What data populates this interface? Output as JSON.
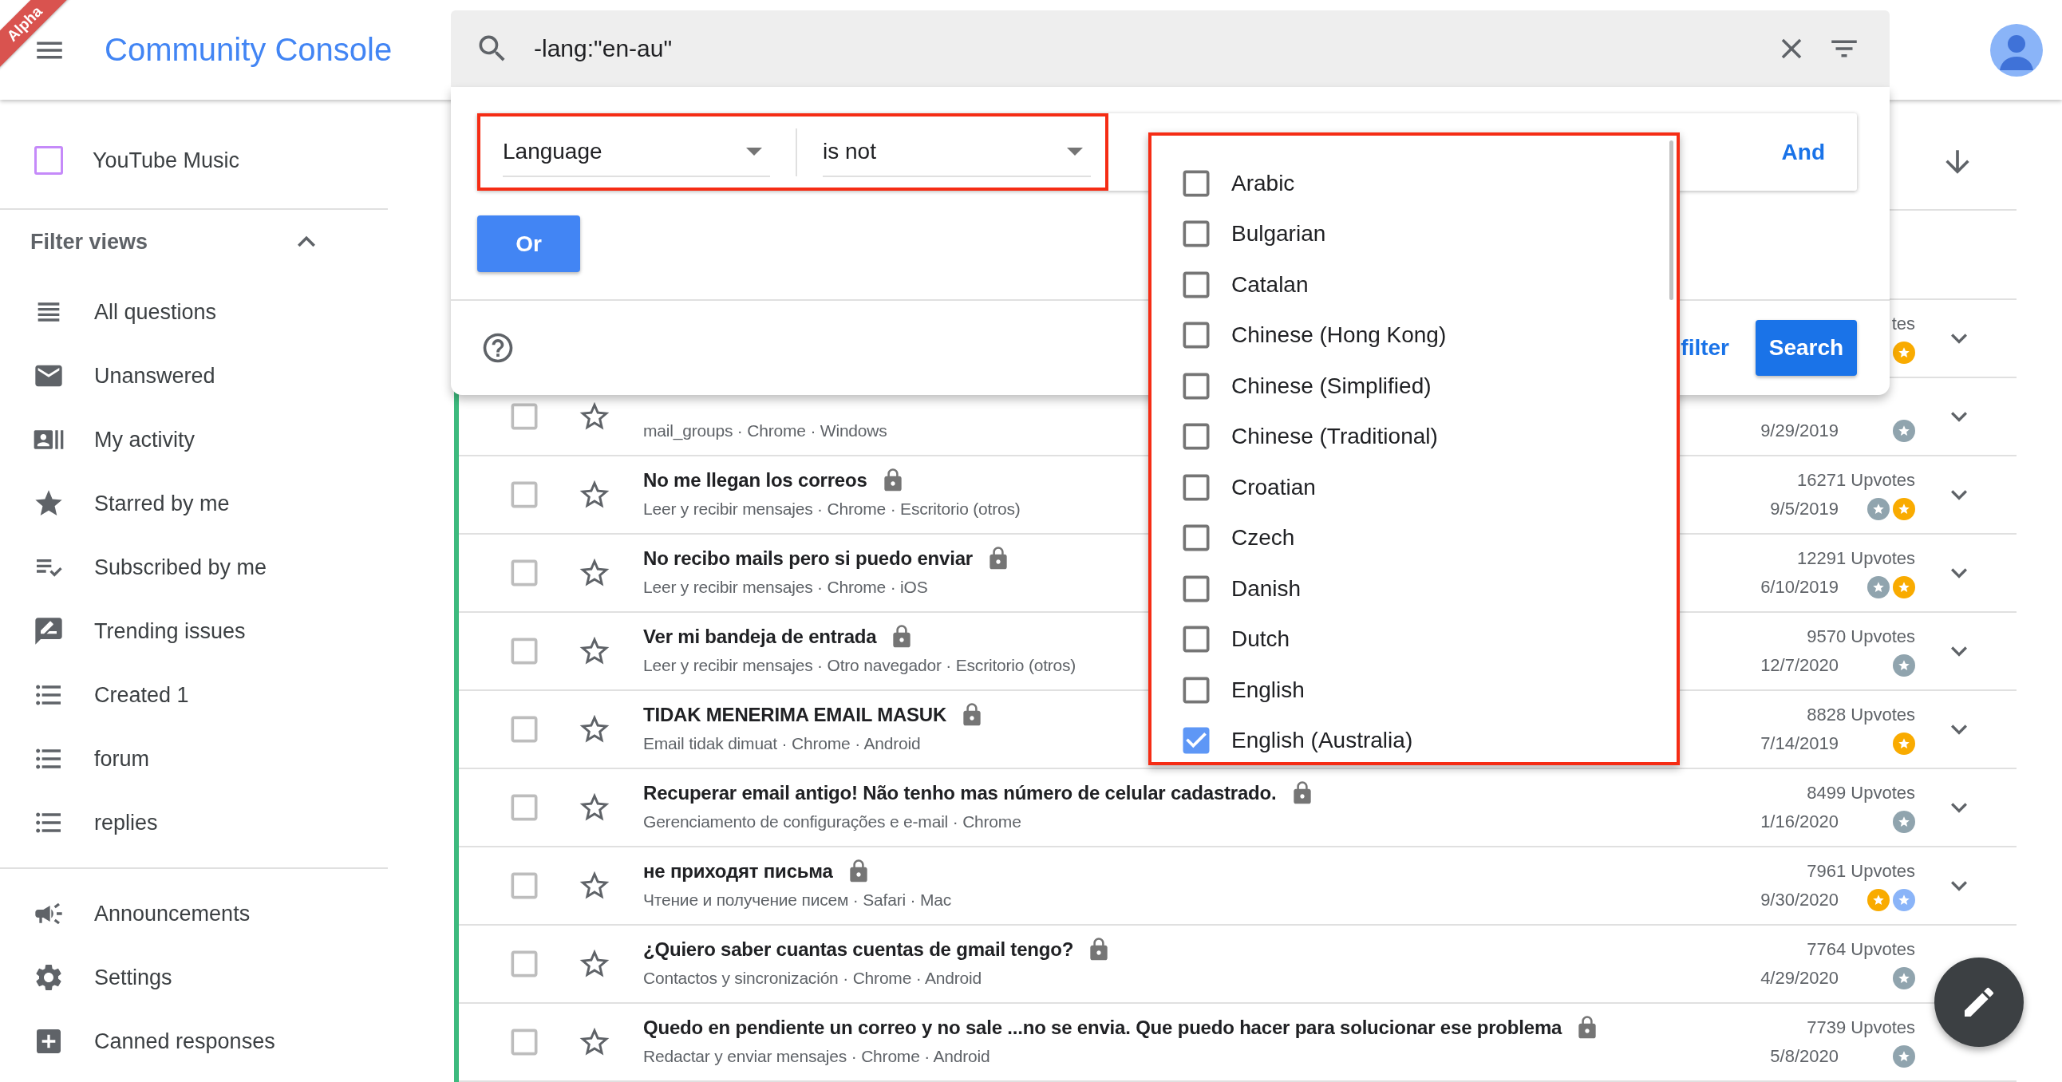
{
  "alpha_ribbon": "Alpha",
  "header": {
    "title": "Community Console"
  },
  "search": {
    "value": "-lang:\"en-au\""
  },
  "sidebar": {
    "channels": [
      {
        "label": "YouTube Music",
        "color": "#c58af9"
      }
    ],
    "filter_views": {
      "title": "Filter views",
      "expanded": true,
      "items": [
        {
          "kind": "all",
          "label": "All questions"
        },
        {
          "kind": "unanswered",
          "label": "Unanswered"
        },
        {
          "kind": "activity",
          "label": "My activity"
        },
        {
          "kind": "starred",
          "label": "Starred by me"
        },
        {
          "kind": "subscribed",
          "label": "Subscribed by me"
        },
        {
          "kind": "trending",
          "label": "Trending issues"
        },
        {
          "kind": "list",
          "label": "Created 1"
        },
        {
          "kind": "list",
          "label": "forum"
        },
        {
          "kind": "list",
          "label": "replies"
        }
      ]
    },
    "bottom_items": [
      {
        "kind": "announcements",
        "label": "Announcements"
      },
      {
        "kind": "settings",
        "label": "Settings"
      },
      {
        "kind": "canned",
        "label": "Canned responses"
      }
    ]
  },
  "filter_popup": {
    "conditions": [
      {
        "field": "Language",
        "operator": "is not"
      }
    ],
    "and_button": "And",
    "or_button": "Or",
    "clear_link": "filter",
    "search_button": "Search",
    "options": [
      {
        "label": "Arabic",
        "checked": false
      },
      {
        "label": "Bulgarian",
        "checked": false
      },
      {
        "label": "Catalan",
        "checked": false
      },
      {
        "label": "Chinese (Hong Kong)",
        "checked": false
      },
      {
        "label": "Chinese (Simplified)",
        "checked": false
      },
      {
        "label": "Chinese (Traditional)",
        "checked": false
      },
      {
        "label": "Croatian",
        "checked": false
      },
      {
        "label": "Czech",
        "checked": false
      },
      {
        "label": "Danish",
        "checked": false
      },
      {
        "label": "Dutch",
        "checked": false
      },
      {
        "label": "English",
        "checked": false
      },
      {
        "label": "English (Australia)",
        "checked": true
      }
    ]
  },
  "questions": [
    {
      "upvotes": "tes",
      "badges": [
        {
          "color": "#f9ab00"
        }
      ],
      "expand_icon": true
    },
    {
      "checked": false,
      "starred": false,
      "subtitle": "mail_groups · Chrome · Windows",
      "date": "9/29/2019",
      "badges": [
        {
          "color": "#90a4ae"
        }
      ],
      "expand_icon": true
    },
    {
      "checked": false,
      "starred": false,
      "title": "No me llegan los correos",
      "locked": true,
      "subtitle": "Leer y recibir mensajes · Chrome · Escritorio (otros)",
      "upvotes": "16271 Upvotes",
      "date": "9/5/2019",
      "badges": [
        {
          "color": "#90a4ae"
        },
        {
          "color": "#f9ab00"
        }
      ],
      "expand_icon": true
    },
    {
      "checked": false,
      "starred": false,
      "title": "No recibo mails pero si puedo enviar",
      "locked": true,
      "subtitle": "Leer y recibir mensajes · Chrome · iOS",
      "upvotes": "12291 Upvotes",
      "date": "6/10/2019",
      "badges": [
        {
          "color": "#90a4ae"
        },
        {
          "color": "#f9ab00"
        }
      ],
      "expand_icon": true
    },
    {
      "checked": false,
      "starred": false,
      "title": "Ver mi bandeja de entrada",
      "locked": true,
      "subtitle": "Leer y recibir mensajes · Otro navegador · Escritorio (otros)",
      "upvotes": "9570 Upvotes",
      "date": "12/7/2020",
      "badges": [
        {
          "color": "#90a4ae"
        }
      ],
      "expand_icon": true
    },
    {
      "checked": false,
      "starred": false,
      "title": "TIDAK MENERIMA EMAIL MASUK",
      "locked": true,
      "subtitle": "Email tidak dimuat · Chrome · Android",
      "upvotes": "8828 Upvotes",
      "date": "7/14/2019",
      "badges": [
        {
          "color": "#f9ab00"
        }
      ],
      "expand_icon": true
    },
    {
      "checked": false,
      "starred": false,
      "title": "Recuperar email antigo! Não tenho mas número de celular cadastrado.",
      "locked": true,
      "subtitle": "Gerenciamento de configurações e e-mail · Chrome",
      "upvotes": "8499 Upvotes",
      "date": "1/16/2020",
      "badges": [
        {
          "color": "#90a4ae"
        }
      ],
      "expand_icon": true
    },
    {
      "checked": false,
      "starred": false,
      "title": "не приходят письма",
      "locked": true,
      "subtitle": "Чтение и получение писем · Safari · Mac",
      "upvotes": "7961 Upvotes",
      "date": "9/30/2020",
      "badges": [
        {
          "color": "#f9ab00"
        },
        {
          "color": "#8ab4f8"
        }
      ],
      "expand_icon": true
    },
    {
      "checked": false,
      "starred": false,
      "title": "¿Quiero saber cuantas cuentas de gmail tengo?",
      "locked": true,
      "subtitle": "Contactos y sincronización · Chrome · Android",
      "upvotes": "7764 Upvotes",
      "date": "4/29/2020",
      "badges": [
        {
          "color": "#90a4ae"
        }
      ],
      "expand_icon": false
    },
    {
      "checked": false,
      "starred": false,
      "title": "Quedo en pendiente un correo y no sale ...no se envia. Que puedo hacer para solucionar ese problema",
      "locked": true,
      "subtitle": "Redactar y enviar mensajes · Chrome · Android",
      "upvotes": "7739 Upvotes",
      "date": "5/8/2020",
      "badges": [
        {
          "color": "#90a4ae"
        }
      ],
      "expand_icon": false
    }
  ]
}
